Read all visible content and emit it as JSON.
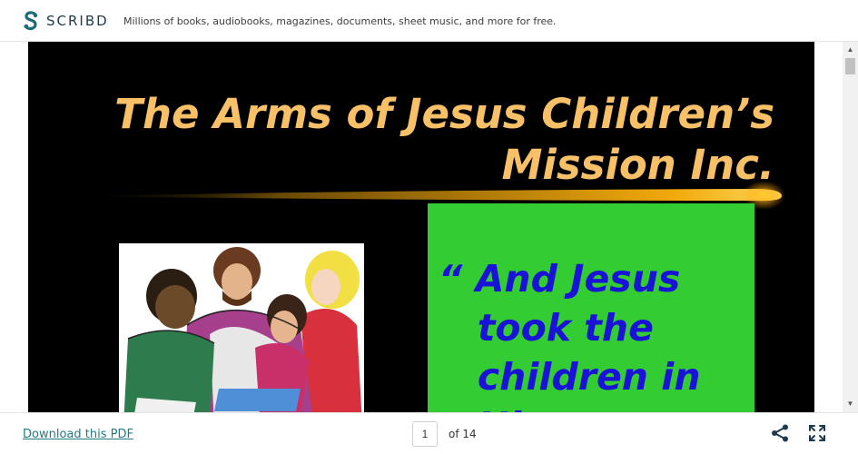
{
  "header": {
    "logo_text": "SCRIBD",
    "tagline": "Millions of books, audiobooks, magazines, documents, sheet music, and more for free."
  },
  "slide": {
    "title_line1": "The Arms of Jesus Children’s",
    "title_line2": "Mission Inc.",
    "quote_lines": [
      "“ And Jesus",
      "   took the",
      "   children in",
      "   His"
    ],
    "colors": {
      "background": "#000000",
      "title": "#f8c067",
      "box": "#33cc33",
      "quote": "#1a12d6"
    }
  },
  "footer": {
    "download_label": "Download this PDF",
    "page_value": "1",
    "page_total": "of 14"
  },
  "icons": {
    "logo": "scribd-logo-icon",
    "share": "share-icon",
    "fullscreen": "fullscreen-icon"
  }
}
